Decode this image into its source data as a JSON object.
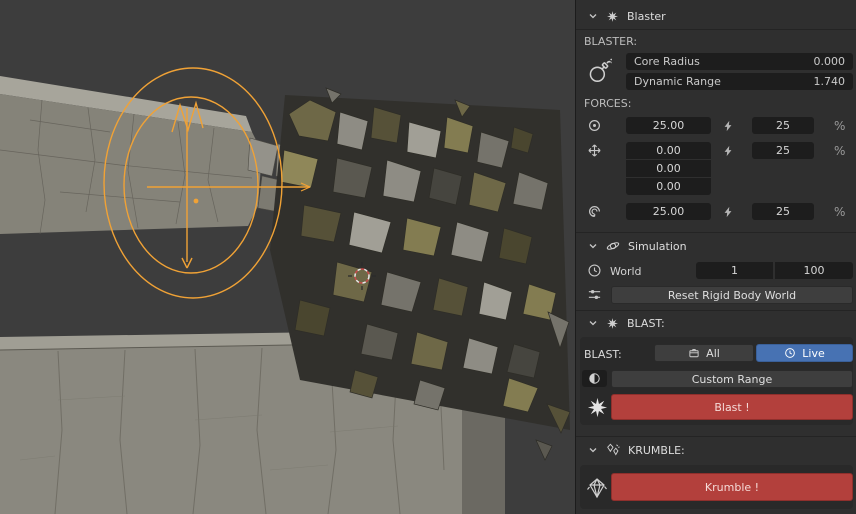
{
  "colors": {
    "viewport_bg": "#3d3d3d",
    "panel_bg": "#2f2f2f",
    "field_bg": "#1d1d1d",
    "button_bg": "#3e3e3e",
    "accent_blue": "#4772b3",
    "danger_red": "#b3403c",
    "gizmo_orange": "#f0a236"
  },
  "blaster": {
    "header": "Blaster",
    "section_label": "BLASTER:",
    "core_radius": {
      "label": "Core Radius",
      "value": "0.000"
    },
    "dynamic_range": {
      "label": "Dynamic Range",
      "value": "1.740"
    },
    "forces_label": "FORCES:",
    "percent_symbol": "%",
    "force_rows": [
      {
        "icon": "point-force-icon",
        "value": "25.00",
        "percent": "25"
      },
      {
        "icon": "directional-force-icon",
        "value": "0.00",
        "percent": "25",
        "vector": [
          "0.00",
          "0.00"
        ]
      },
      {
        "icon": "vortex-force-icon",
        "value": "25.00",
        "percent": "25"
      }
    ]
  },
  "simulation": {
    "header": "Simulation",
    "world_label": "World",
    "frame_start": "1",
    "frame_end": "100",
    "reset_button": "Reset Rigid Body World"
  },
  "blast": {
    "header": "BLAST:",
    "row_label": "BLAST:",
    "all_button": "All",
    "live_button": "Live",
    "custom_range_button": "Custom Range",
    "blast_button": "Blast !"
  },
  "krumble": {
    "header": "KRUMBLE:",
    "krumble_button": "Krumble !"
  }
}
